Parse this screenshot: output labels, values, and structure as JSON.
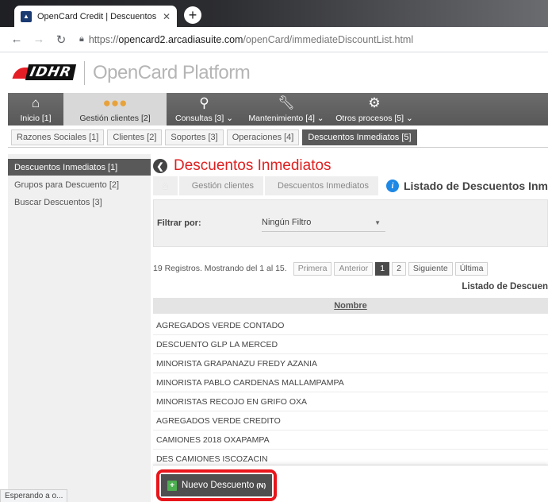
{
  "browser": {
    "tab_title": "OpenCard Credit | Descuentos In",
    "url_proto": "https://",
    "url_host": "opencard2.arcadiasuite.com",
    "url_path": "/openCard/immediateDiscountList.html",
    "status_text": "Esperando a o..."
  },
  "header": {
    "logo_text": "IDHR",
    "platform": "OpenCard Platform"
  },
  "mainnav": {
    "items": [
      {
        "label": "Inicio [1]",
        "icon": "home-icon"
      },
      {
        "label": "Gestión clientes [2]",
        "icon": "users-icon"
      },
      {
        "label": "Consultas [3] ⌄",
        "icon": "query-icon"
      },
      {
        "label": "Mantenimiento [4] ⌄",
        "icon": "wrench-icon"
      },
      {
        "label": "Otros procesos [5] ⌄",
        "icon": "gear-icon"
      }
    ]
  },
  "subnav": {
    "tabs": [
      "Razones Sociales [1]",
      "Clientes [2]",
      "Soportes [3]",
      "Operaciones [4]",
      "Descuentos Inmediatos [5]"
    ]
  },
  "sidebar": {
    "items": [
      "Descuentos Inmediatos [1]",
      "Grupos para Descuento [2]",
      "Buscar Descuentos [3]"
    ]
  },
  "page": {
    "title": "Descuentos Inmediatos",
    "breadcrumb": [
      "Gestión clientes",
      "Descuentos Inmediatos"
    ],
    "breadcrumb_current": "Listado de Descuentos Inm"
  },
  "filter": {
    "label": "Filtrar por:",
    "selected": "Ningún Filtro"
  },
  "pager": {
    "records": "19 Registros. Mostrando del 1 al 15.",
    "first": "Primera",
    "prev": "Anterior",
    "page1": "1",
    "page2": "2",
    "next": "Siguiente",
    "last": "Última"
  },
  "table": {
    "caption": "Listado de Descuen",
    "column": "Nombre",
    "rows": [
      "AGREGADOS VERDE CONTADO",
      "DESCUENTO GLP LA MERCED",
      "MINORISTA GRAPANAZU FREDY AZANIA",
      "MINORISTA PABLO CARDENAS MALLAMPAMPA",
      "MINORISTAS RECOJO EN GRIFO OXA",
      "AGREGADOS VERDE CREDITO",
      "CAMIONES 2018 OXAPAMPA",
      "DES CAMIONES ISCOZACIN"
    ]
  },
  "footer": {
    "new_button": "Nuevo Descuento",
    "shortcut": "(N)"
  },
  "colors": {
    "accent_red": "#e02020",
    "nav_gray": "#5f5f5f",
    "highlight": "#e8161b"
  }
}
